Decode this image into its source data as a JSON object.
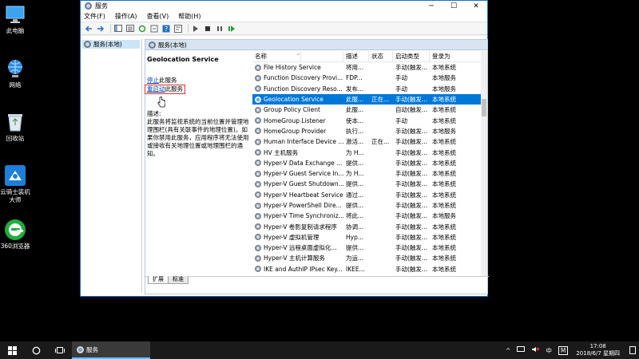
{
  "desktop": {
    "icons": [
      {
        "label": "此电脑"
      },
      {
        "label": "网络"
      },
      {
        "label": "回收站"
      },
      {
        "label": "云骑士装机大师"
      },
      {
        "label": "360浏览器"
      }
    ]
  },
  "window": {
    "title": "服务",
    "controls": {
      "minimize": "─",
      "maximize": "☐",
      "close": "✕"
    },
    "menu": [
      "文件(F)",
      "操作(A)",
      "查看(V)",
      "帮助(H)"
    ],
    "tree_root": "服务(本地)",
    "pane_title": "服务(本地)",
    "detail": {
      "service_name": "Geolocation Service",
      "stop_link": "停止",
      "stop_suffix": "此服务",
      "restart_link": "重启动",
      "restart_suffix": "此服务",
      "desc_label": "描述:",
      "desc_text": "此服务将监视系统的当前位置并管理地理围栏(具有关联事件的地理位置)。如果你禁用此服务，应用程序将无法使用或接收有关地理位置或地理围栏的通知。"
    },
    "columns": [
      "名称",
      "描述",
      "状态",
      "启动类型",
      "登录为"
    ],
    "rows": [
      {
        "name": "File History Service",
        "desc": "将用...",
        "status": "",
        "startup": "手动(触发...",
        "logon": "本地系统"
      },
      {
        "name": "Function Discovery Provi...",
        "desc": "FDP...",
        "status": "",
        "startup": "手动",
        "logon": "本地服务"
      },
      {
        "name": "Function Discovery Reso...",
        "desc": "发布...",
        "status": "",
        "startup": "手动",
        "logon": "本地服务"
      },
      {
        "name": "Geolocation Service",
        "desc": "此服...",
        "status": "正在...",
        "startup": "手动(触发...",
        "logon": "本地系统"
      },
      {
        "name": "Group Policy Client",
        "desc": "此服...",
        "status": "",
        "startup": "自动(触发...",
        "logon": "本地系统"
      },
      {
        "name": "HomeGroup Listener",
        "desc": "使本...",
        "status": "",
        "startup": "手动",
        "logon": "本地系统"
      },
      {
        "name": "HomeGroup Provider",
        "desc": "执行...",
        "status": "",
        "startup": "手动(触发...",
        "logon": "本地服务"
      },
      {
        "name": "Human Interface Device ...",
        "desc": "激活...",
        "status": "正在...",
        "startup": "手动(触发...",
        "logon": "本地系统"
      },
      {
        "name": "HV 主机服务",
        "desc": "为 H...",
        "status": "",
        "startup": "手动(触发...",
        "logon": "本地系统"
      },
      {
        "name": "Hyper-V Data Exchange ...",
        "desc": "提供...",
        "status": "",
        "startup": "手动(触发...",
        "logon": "本地系统"
      },
      {
        "name": "Hyper-V Guest Service In...",
        "desc": "为 H...",
        "status": "",
        "startup": "手动(触发...",
        "logon": "本地系统"
      },
      {
        "name": "Hyper-V Guest Shutdown...",
        "desc": "提供...",
        "status": "",
        "startup": "手动(触发...",
        "logon": "本地系统"
      },
      {
        "name": "Hyper-V Heartbeat Service",
        "desc": "通过...",
        "status": "",
        "startup": "手动(触发...",
        "logon": "本地系统"
      },
      {
        "name": "Hyper-V PowerShell Dire...",
        "desc": "提供...",
        "status": "",
        "startup": "手动(触发...",
        "logon": "本地系统"
      },
      {
        "name": "Hyper-V Time Synchroniz...",
        "desc": "将此...",
        "status": "",
        "startup": "手动(触发...",
        "logon": "本地服务"
      },
      {
        "name": "Hyper-V 卷影复制请求程序",
        "desc": "协调...",
        "status": "",
        "startup": "手动(触发...",
        "logon": "本地系统"
      },
      {
        "name": "Hyper-V 虚拟机管理",
        "desc": "Hyp...",
        "status": "",
        "startup": "手动(触发...",
        "logon": "本地系统"
      },
      {
        "name": "Hyper-V 远程桌面虚拟化...",
        "desc": "提供...",
        "status": "",
        "startup": "手动(触发...",
        "logon": "本地系统"
      },
      {
        "name": "Hyper-V 主机计算服务",
        "desc": "为运...",
        "status": "",
        "startup": "手动(触发...",
        "logon": "本地系统"
      },
      {
        "name": "IKE and AuthIP IPsec Key...",
        "desc": "IKEE...",
        "status": "",
        "startup": "手动(触发...",
        "logon": "本地系统"
      }
    ],
    "tabs": [
      "扩展",
      "标准"
    ]
  },
  "taskbar": {
    "app_label": "服务",
    "tray": {
      "lang": "中",
      "ime": "M",
      "time": "17:08",
      "date": "2018/6/7 星期四"
    }
  },
  "colors": {
    "selection": "#0078d7",
    "link": "#0645ad",
    "highlight_box": "#e03030"
  }
}
